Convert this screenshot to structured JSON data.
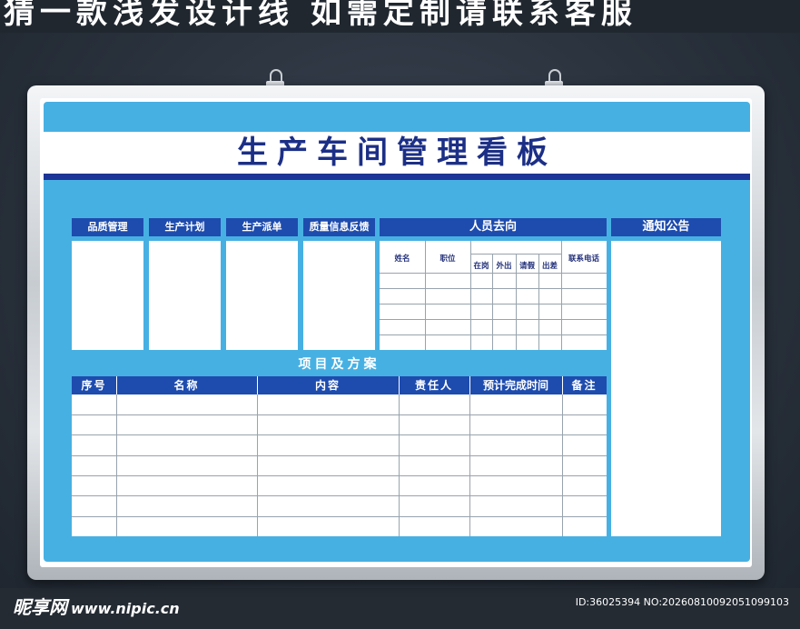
{
  "banner_text": "猜一款浅发设计线 如需定制请联系客服",
  "board": {
    "title": "生产车间管理看板",
    "panels": [
      {
        "label": "品质管理"
      },
      {
        "label": "生产计划"
      },
      {
        "label": "生产派单"
      },
      {
        "label": "质量信息反馈"
      }
    ],
    "personnel": {
      "label": "人员去向",
      "col_name": "姓名",
      "col_position": "职位",
      "col_present": "在岗",
      "col_out": "外出",
      "col_leave": "请假",
      "col_trip": "出差",
      "col_phone": "联系电话"
    },
    "notice": {
      "label": "通知公告"
    },
    "project": {
      "title": "项目及方案",
      "columns": [
        "序号",
        "名称",
        "内容",
        "责任人",
        "预计完成时间",
        "备注"
      ]
    }
  },
  "watermark": {
    "site": "昵享网",
    "url": "www.nipic.cn",
    "id_text": "ID:36025394 NO:20260810092051099103"
  },
  "colors": {
    "board_blue": "#47b0e3",
    "header_blue": "#1e4cae",
    "title_navy": "#1c2f86"
  }
}
